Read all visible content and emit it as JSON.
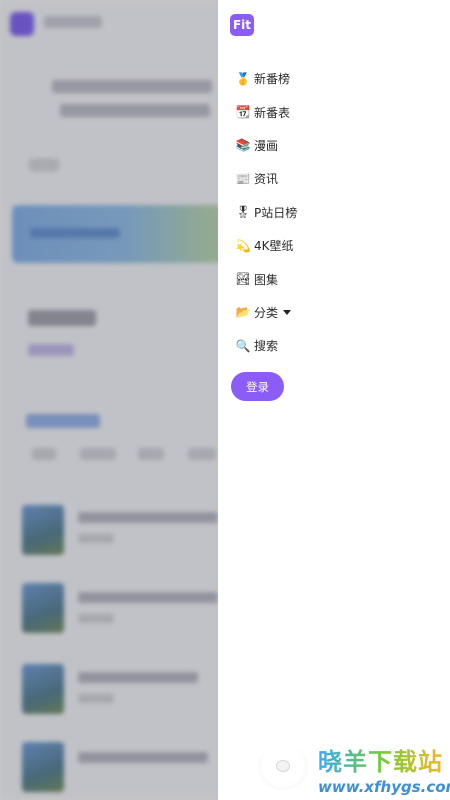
{
  "drawer": {
    "logo_text": "Fit",
    "menu": [
      {
        "icon": "🥇",
        "icon_name": "medal-icon",
        "label": "新番榜"
      },
      {
        "icon": "📆",
        "icon_name": "calendar-icon",
        "label": "新番表"
      },
      {
        "icon": "📚",
        "icon_name": "books-icon",
        "label": "漫画"
      },
      {
        "icon": "📰",
        "icon_name": "newspaper-icon",
        "label": "资讯"
      },
      {
        "icon": "🎖",
        "icon_name": "military-medal-icon",
        "label": "P站日榜"
      },
      {
        "icon": "💫",
        "icon_name": "dizzy-star-icon",
        "label": "4K壁纸"
      },
      {
        "icon": "🏞",
        "icon_name": "landscape-icon",
        "label": "图集"
      },
      {
        "icon": "📂",
        "icon_name": "folder-icon",
        "label": "分类",
        "has_dropdown": true
      },
      {
        "icon": "🔍",
        "icon_name": "search-icon",
        "label": "搜索"
      }
    ],
    "login_label": "登录"
  },
  "watermark": {
    "brand": "晓羊下载站",
    "url": "www.xfhygs.com"
  },
  "colors": {
    "accent": "#8b5cf6",
    "overlay": "#3c3e48"
  }
}
